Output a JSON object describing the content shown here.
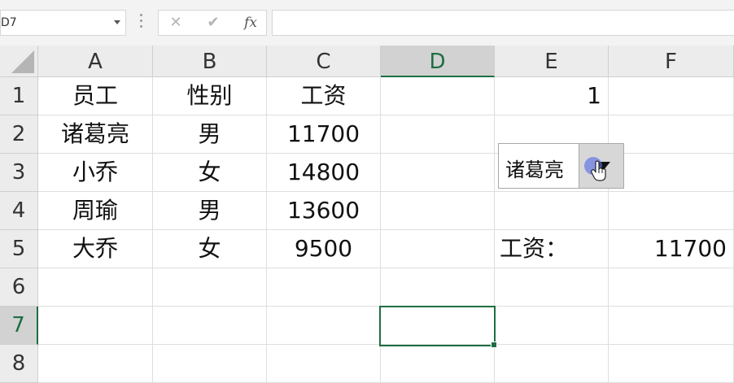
{
  "formula_bar": {
    "name_box": "D7",
    "cancel_glyph": "✕",
    "enter_glyph": "✔",
    "fx_label": "fx",
    "formula": ""
  },
  "columns": [
    "A",
    "B",
    "C",
    "D",
    "E",
    "F"
  ],
  "rows": [
    "1",
    "2",
    "3",
    "4",
    "5",
    "6",
    "7",
    "8"
  ],
  "active_cell": {
    "column": "D",
    "row": "7"
  },
  "cells": {
    "A1": "员工",
    "B1": "性别",
    "C1": "工资",
    "E1": "1",
    "A2": "诸葛亮",
    "B2": "男",
    "C2": "11700",
    "A3": "小乔",
    "B3": "女",
    "C3": "14800",
    "A4": "周瑜",
    "B4": "男",
    "C4": "13600",
    "A5": "大乔",
    "B5": "女",
    "C5": "9500",
    "E5": "工资：",
    "F5": "11700"
  },
  "combo_box": {
    "selected_value": "诸葛亮",
    "icon": "chevron-down-icon"
  },
  "colors": {
    "accent_green": "#1e6e43",
    "header_bg": "#ececec",
    "cursor_highlight": "#5a6ee6"
  }
}
